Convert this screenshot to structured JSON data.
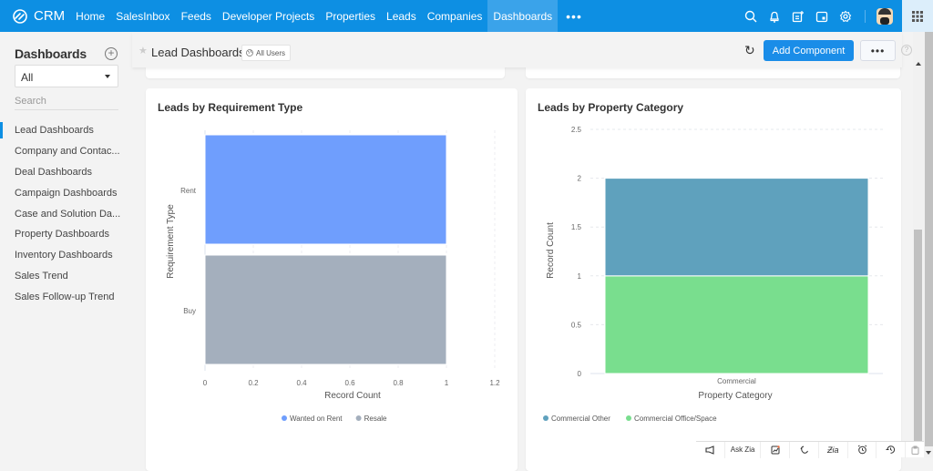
{
  "app": {
    "name": "CRM"
  },
  "nav": {
    "items": [
      {
        "label": "Home",
        "active": false
      },
      {
        "label": "SalesInbox",
        "active": false
      },
      {
        "label": "Feeds",
        "active": false
      },
      {
        "label": "Developer Projects",
        "active": false
      },
      {
        "label": "Properties",
        "active": false
      },
      {
        "label": "Leads",
        "active": false
      },
      {
        "label": "Companies",
        "active": false
      },
      {
        "label": "Dashboards",
        "active": true
      }
    ],
    "more_label": "•••",
    "icons": [
      "search-icon",
      "bell-icon",
      "add-note-icon",
      "calendar-icon",
      "gear-icon",
      "avatar",
      "apps-grid-icon"
    ]
  },
  "sidebar": {
    "title": "Dashboards",
    "add_label": "+",
    "filter_value": "All",
    "search_placeholder": "Search",
    "items": [
      {
        "label": "Lead Dashboards",
        "active": true
      },
      {
        "label": "Company and Contac...",
        "active": false
      },
      {
        "label": "Deal Dashboards",
        "active": false
      },
      {
        "label": "Campaign Dashboards",
        "active": false
      },
      {
        "label": "Case and Solution Da...",
        "active": false
      },
      {
        "label": "Property Dashboards",
        "active": false
      },
      {
        "label": "Inventory Dashboards",
        "active": false
      },
      {
        "label": "Sales Trend",
        "active": false
      },
      {
        "label": "Sales Follow-up Trend",
        "active": false
      }
    ]
  },
  "header": {
    "title": "Lead Dashboards",
    "visibility": "All Users",
    "refresh_icon": "refresh-icon",
    "add_component_label": "Add Component",
    "more_label": "•••",
    "help_label": "?"
  },
  "bottom_bar": {
    "items": [
      "announce-icon",
      "Ask Zia",
      "chart-icon",
      "pin-icon",
      "zia-icon",
      "alarm-icon",
      "history-icon",
      "notes-icon"
    ]
  },
  "colors": {
    "brand": "#0d8fe3",
    "rent": "#6f9efd",
    "resale": "#a4afbd",
    "commercial_other": "#5fa1bd",
    "commercial_office": "#79de8e"
  },
  "chart_data": [
    {
      "type": "bar",
      "orientation": "horizontal",
      "title": "Leads by Requirement Type",
      "xlabel": "Record Count",
      "ylabel": "Requirement Type",
      "categories": [
        "Rent",
        "Buy"
      ],
      "series": [
        {
          "name": "Wanted on Rent",
          "values": [
            1,
            0
          ]
        },
        {
          "name": "Resale",
          "values": [
            0,
            1
          ]
        }
      ],
      "xlim": [
        0,
        1.2
      ],
      "xticks": [
        "0",
        "0.2",
        "0.4",
        "0.6",
        "0.8",
        "1",
        "1.2"
      ],
      "grid": true,
      "legend": "bottom-center"
    },
    {
      "type": "bar",
      "orientation": "vertical",
      "stacked": true,
      "title": "Leads by Property Category",
      "xlabel": "Property Category",
      "ylabel": "Record Count",
      "categories": [
        "Commercial"
      ],
      "series": [
        {
          "name": "Commercial Office/Space",
          "values": [
            1
          ]
        },
        {
          "name": "Commercial Other",
          "values": [
            1
          ]
        }
      ],
      "legend_order": [
        "Commercial Other",
        "Commercial Office/Space"
      ],
      "ylim": [
        0,
        2.5
      ],
      "yticks": [
        "0",
        "0.5",
        "1",
        "1.5",
        "2",
        "2.5"
      ],
      "grid": true,
      "legend": "bottom-left"
    }
  ]
}
